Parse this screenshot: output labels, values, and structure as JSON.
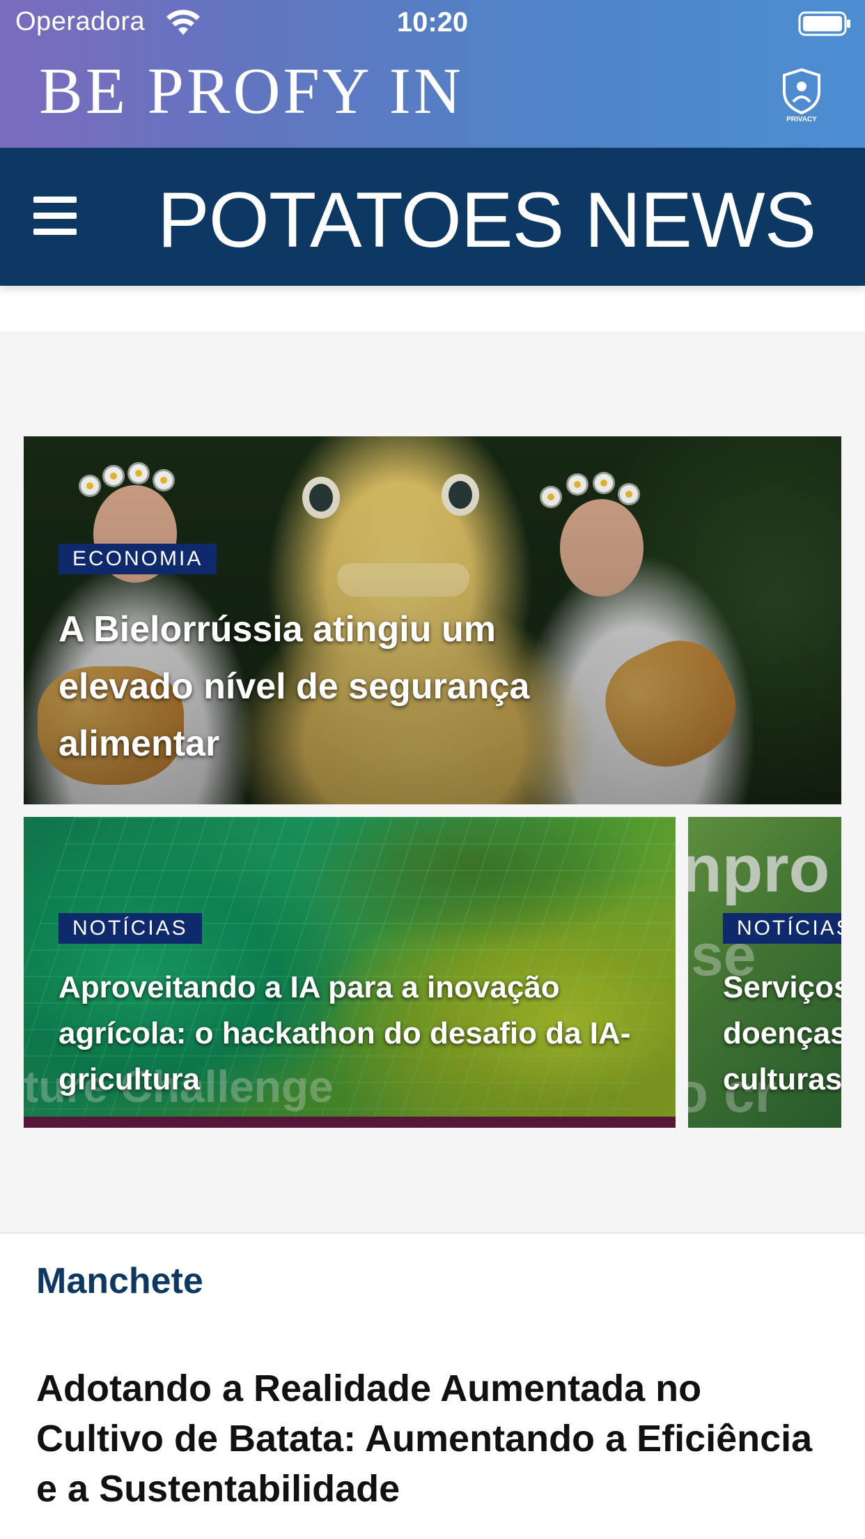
{
  "status_bar": {
    "carrier": "Operadora",
    "time": "10:20"
  },
  "header": {
    "brand": "BE PROFY IN",
    "privacy_badge_label": "PRIVACY"
  },
  "navbar": {
    "title": "POTATOES NEWS"
  },
  "featured": [
    {
      "category": "ECONOMIA",
      "title": "A Bielorrússia atingiu um elevado nível de segurança alimentar"
    },
    {
      "category": "NOTÍCIAS",
      "title": "Aproveitando a IA para a inovação agrícola: o hackathon do desafio da IA-gricultura"
    },
    {
      "category": "NOTÍCIAS",
      "title": "Serviços de doenças culturas"
    }
  ],
  "headlines": {
    "section_title": "Manchete",
    "items": [
      {
        "title": "Adotando a Realidade Aumentada no Cultivo de Batata: Aumentando a Eficiência e a Sustentabilidade"
      }
    ]
  },
  "colors": {
    "navbar": "#0c3863",
    "badge": "#0e2a6d",
    "gradient_start": "#7b6bbd",
    "gradient_end": "#4d8ed2"
  }
}
